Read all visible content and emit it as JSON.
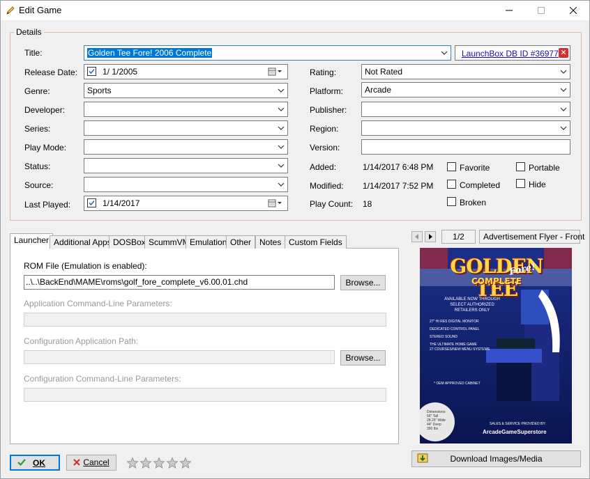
{
  "window": {
    "title": "Edit Game"
  },
  "details": {
    "group_label": "Details",
    "title_label": "Title:",
    "title_value": "Golden Tee Fore! 2006 Complete",
    "launchbox_link": "LaunchBox DB ID #36977",
    "release_date_label": "Release Date:",
    "release_date_value": "1/  1/2005",
    "genre_label": "Genre:",
    "genre_value": "Sports",
    "developer_label": "Developer:",
    "developer_value": "",
    "series_label": "Series:",
    "series_value": "",
    "play_mode_label": "Play Mode:",
    "play_mode_value": "",
    "status_label": "Status:",
    "status_value": "",
    "source_label": "Source:",
    "source_value": "",
    "last_played_label": "Last Played:",
    "last_played_value": "1/14/2017",
    "rating_label": "Rating:",
    "rating_value": "Not Rated",
    "platform_label": "Platform:",
    "platform_value": "Arcade",
    "publisher_label": "Publisher:",
    "publisher_value": "",
    "region_label": "Region:",
    "region_value": "",
    "version_label": "Version:",
    "version_value": "",
    "added_label": "Added:",
    "added_value": "1/14/2017 6:48 PM",
    "modified_label": "Modified:",
    "modified_value": "1/14/2017 7:52 PM",
    "play_count_label": "Play Count:",
    "play_count_value": "18",
    "checkboxes": {
      "favorite": "Favorite",
      "portable": "Portable",
      "completed": "Completed",
      "hide": "Hide",
      "broken": "Broken"
    }
  },
  "tabs": [
    "Launcher",
    "Additional Apps",
    "DOSBox",
    "ScummVM",
    "Emulation",
    "Other",
    "Notes",
    "Custom Fields"
  ],
  "launcher": {
    "rom_label": "ROM File (Emulation is enabled):",
    "rom_value": "..\\..\\BackEnd\\MAME\\roms\\golf_fore_complete_v6.00.01.chd",
    "browse_label": "Browse...",
    "app_cmd_label": "Application Command-Line Parameters:",
    "config_path_label": "Configuration Application Path:",
    "config_cmd_label": "Configuration Command-Line Parameters:"
  },
  "images": {
    "counter": "1/2",
    "image_type": "Advertisement Flyer - Front",
    "download_label": "Download Images/Media"
  },
  "flyer": {
    "logo_line1": "GOLDEN TEE",
    "logo_line2": "COMPLETE",
    "logo_script": "Fore!",
    "availability": "AVAILABLE NOW THROUGH\nSELECT AUTHORIZED\nRETAILERS ONLY",
    "bullets": [
      "27\" HI RES DIGITAL MONITOR",
      "DEDICATED CONTROL PANEL",
      "STEREO SOUND",
      "THE ULTIMATE HOME GAME\n27 COURSES/NEW MENU SYSTEMS"
    ],
    "oem": "* OEM APPROVED CABINET",
    "dims": "Dimensions:\n66\" Tall\n28.25\" Wide\n44\" Deep\n350 lbs",
    "sales": "SALES & SERVICE PROVIDED BY:",
    "brand": "ArcadeGameSuperstore"
  },
  "footer": {
    "ok_label": "OK",
    "cancel_label": "Cancel",
    "rating_stars": 0,
    "rating_max": 5
  }
}
